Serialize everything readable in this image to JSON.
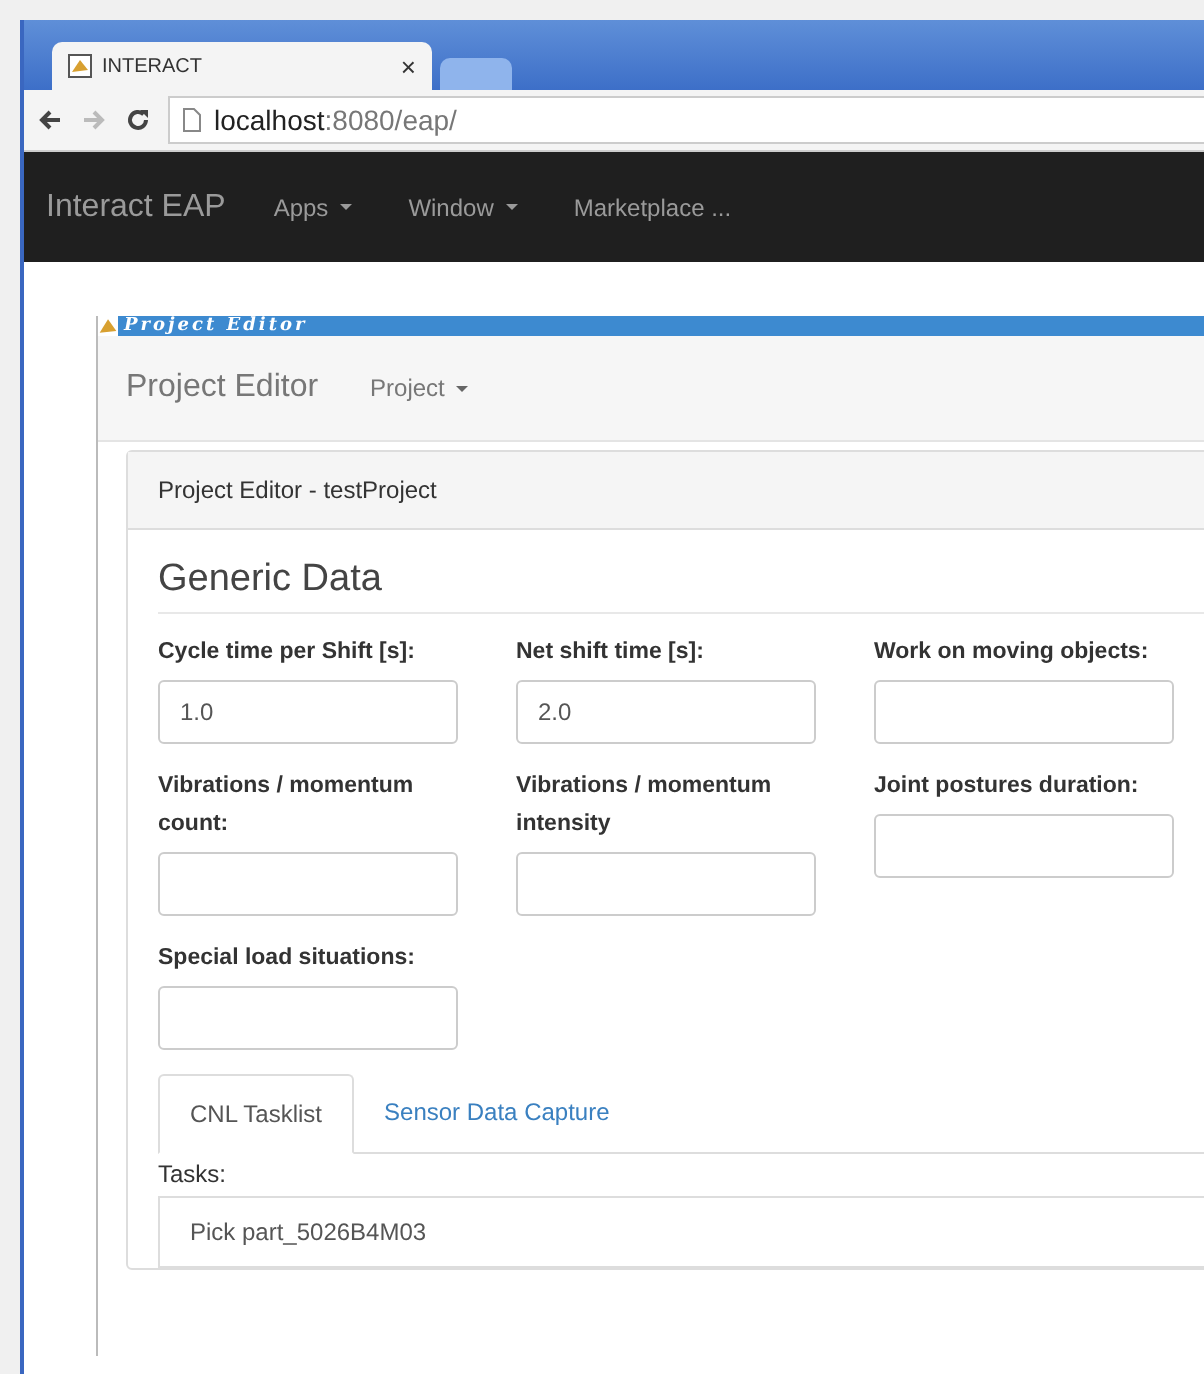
{
  "browser": {
    "tabs": [
      {
        "title": "INTERACT",
        "close": "×",
        "selected": true
      },
      {
        "selected": false
      }
    ],
    "url_host": "localhost",
    "url_rest": ":8080/eap/"
  },
  "app_nav": {
    "brand": "Interact EAP",
    "menus": [
      {
        "label": "Apps",
        "dropdown": true
      },
      {
        "label": "Window",
        "dropdown": true
      },
      {
        "label": "Marketplace ...",
        "dropdown": false
      }
    ]
  },
  "window": {
    "title": "Project Editor",
    "brand": "Project Editor",
    "menus": [
      {
        "label": "Project",
        "dropdown": true
      }
    ]
  },
  "panel": {
    "heading": "Project Editor - testProject",
    "section": "Generic Data",
    "fields": [
      {
        "label": "Cycle time per Shift [s]:",
        "value": "1.0"
      },
      {
        "label": "Net shift time [s]:",
        "value": "2.0"
      },
      {
        "label": "Work on moving objects:"
      },
      {
        "label": "Vibrations / momentum count:"
      },
      {
        "label": "Vibrations / momentum intensity"
      },
      {
        "label": "Joint postures duration:"
      },
      {
        "label": "Special load situations:"
      }
    ],
    "tabs": [
      {
        "label": "CNL Tasklist",
        "selected": true
      },
      {
        "label": "Sensor Data Capture",
        "selected": false
      }
    ],
    "tasks_label": "Tasks:",
    "tasks": [
      "Pick part_5026B4M03"
    ]
  }
}
